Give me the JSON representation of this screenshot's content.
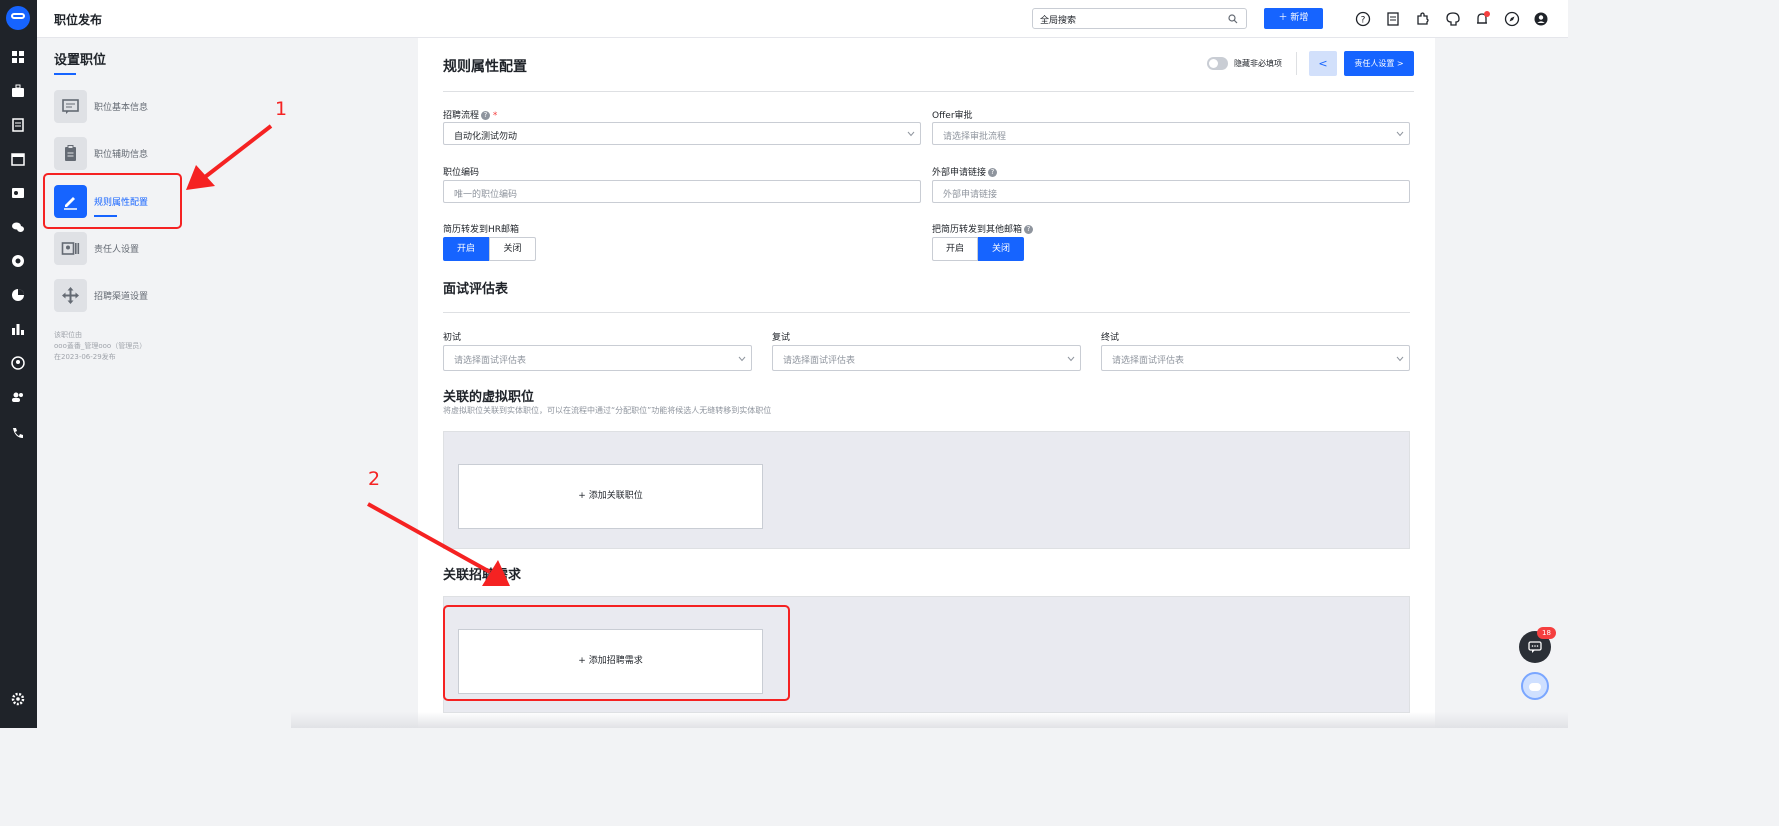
{
  "topbar": {
    "title": "职位发布",
    "search_label": "全局搜索",
    "add_label": "新增"
  },
  "sidebar": {
    "title": "设置职位",
    "steps": [
      {
        "label": "职位基本信息"
      },
      {
        "label": "职位辅助信息"
      },
      {
        "label": "规则属性配置"
      },
      {
        "label": "责任人设置"
      },
      {
        "label": "招聘渠道设置"
      }
    ],
    "meta": [
      "该职位由",
      "ooo蓋番_管理ooo（管理员）",
      "在2023-06-29发布"
    ]
  },
  "header": {
    "title": "规则属性配置",
    "toggle_label": "隐藏非必填项",
    "prev_label": "<",
    "next_label": "责任人设置 >"
  },
  "form": {
    "process_label": "招聘流程",
    "process_value": "自动化测试勿动",
    "offer_label": "Offer审批",
    "offer_placeholder": "请选择审批流程",
    "code_label": "职位编码",
    "code_placeholder": "唯一的职位编码",
    "link_label": "外部申请链接",
    "link_placeholder": "外部申请链接",
    "hr_mail_label": "简历转发到HR邮箱",
    "other_mail_label": "把简历转发到其他邮箱",
    "on_label": "开启",
    "off_label": "关闭"
  },
  "interview": {
    "title": "面试评估表",
    "first_label": "初试",
    "second_label": "复试",
    "final_label": "终试",
    "placeholder": "请选择面试评估表"
  },
  "virtual": {
    "title": "关联的虚拟职位",
    "desc": "将虚拟职位关联到实体职位，可以在流程中通过“分配职位”功能将候选人无缝转移到实体职位",
    "add_label": "+ 添加关联职位"
  },
  "demand": {
    "title": "关联招聘需求",
    "add_label": "+ 添加招聘需求"
  },
  "annotations": {
    "one": "1",
    "two": "2"
  },
  "widgets": {
    "chat_badge": "18"
  },
  "colors": {
    "accent": "#1664ff",
    "annotation": "#f52222"
  }
}
